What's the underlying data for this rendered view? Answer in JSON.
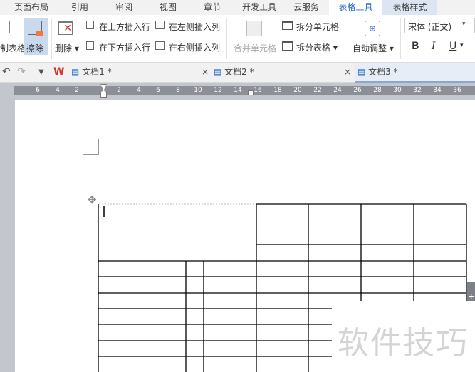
{
  "menu_tabs": [
    "页面布局",
    "引用",
    "审阅",
    "视图",
    "章节",
    "开发工具",
    "云服务",
    "表格工具",
    "表格样式"
  ],
  "active_tab": "表格工具",
  "ribbon": {
    "draw_table": "绘制表格",
    "erase": "擦除",
    "delete": "删除",
    "insert_above": "在上方插入行",
    "insert_below": "在下方插入行",
    "insert_left": "在左侧插入列",
    "insert_right": "在右侧插入列",
    "merge_cells": "合并单元格",
    "split_cells": "拆分单元格",
    "split_table": "拆分表格",
    "auto_fit": "自动调整",
    "font": "宋体 (正文)",
    "bold": "B",
    "italic": "I",
    "underline": "U"
  },
  "doc_tabs": [
    {
      "label": "文档1 *"
    },
    {
      "label": "文档2 *"
    },
    {
      "label": "文档3 *"
    }
  ],
  "ruler_ticks": [
    "6",
    "4",
    "2",
    "2",
    "4",
    "6",
    "8",
    "10",
    "12",
    "14",
    "16",
    "18",
    "20",
    "22",
    "24",
    "26",
    "28",
    "30",
    "32",
    "34",
    "36"
  ],
  "watermark": "软件技巧",
  "colors": {
    "accent": "#2b6fc7",
    "ribbon_bg": "#ffffff",
    "page_bg": "#c3c6cc"
  }
}
